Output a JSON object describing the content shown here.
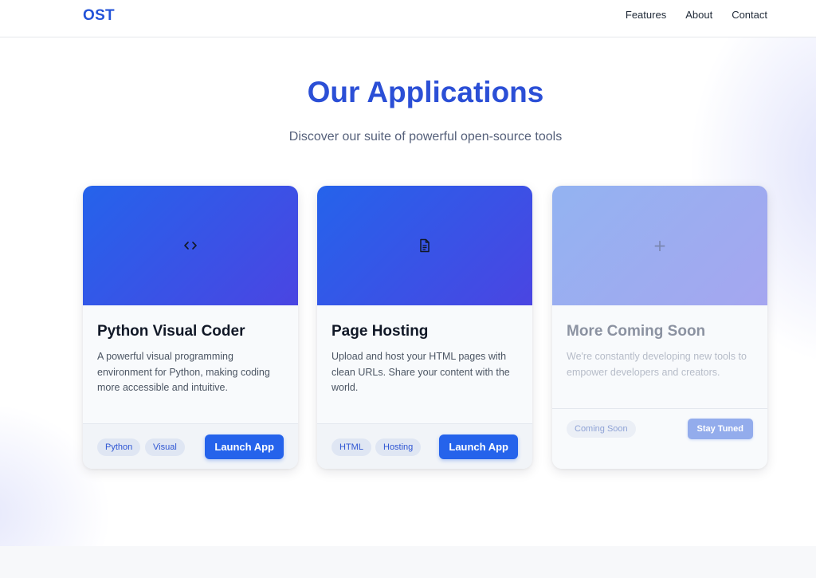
{
  "nav": {
    "logo": "OST",
    "links": [
      "Features",
      "About",
      "Contact"
    ]
  },
  "hero": {
    "title": "Our Applications",
    "subtitle": "Discover our suite of powerful open-source tools"
  },
  "cards": [
    {
      "icon": "code-icon",
      "title": "Python Visual Coder",
      "description": "A powerful visual programming environment for Python, making coding more accessible and intuitive.",
      "tags": [
        "Python",
        "Visual"
      ],
      "button": "Launch App"
    },
    {
      "icon": "document-icon",
      "title": "Page Hosting",
      "description": "Upload and host your HTML pages with clean URLs. Share your content with the world.",
      "tags": [
        "HTML",
        "Hosting"
      ],
      "button": "Launch App"
    },
    {
      "icon": "plus-icon",
      "title": "More Coming Soon",
      "description": "We're constantly developing new tools to empower developers and creators.",
      "tags": [
        "Coming Soon"
      ],
      "button": "Stay Tuned"
    }
  ],
  "colors": {
    "accent": "#2563eb",
    "title": "#2b4fd6",
    "banner_start": "#2563eb",
    "banner_end": "#4a45e2",
    "faded_banner_start": "#93b3f1",
    "faded_banner_end": "#a5a6f0"
  }
}
